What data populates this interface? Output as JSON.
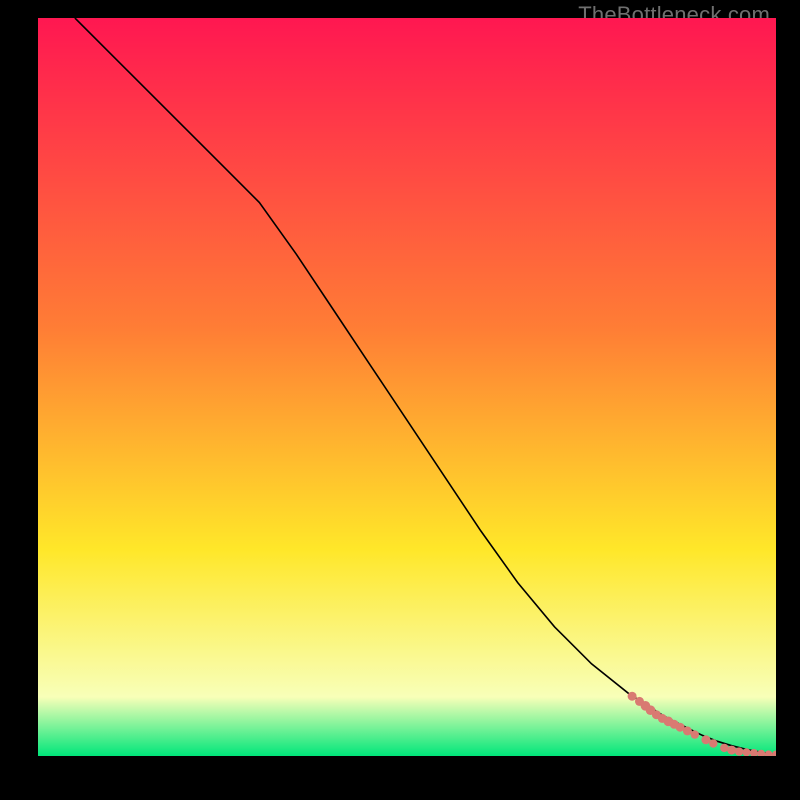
{
  "watermark": "TheBottleneck.com",
  "colors": {
    "grad_top": "#ff1751",
    "grad_orange": "#ff7d35",
    "grad_yellow": "#ffe729",
    "grad_pale": "#f8ffb8",
    "grad_green": "#00e67a",
    "points_fill": "#d97a72",
    "line": "#000000"
  },
  "chart_data": {
    "type": "line",
    "title": "",
    "xlabel": "",
    "ylabel": "",
    "xlim": [
      0,
      100
    ],
    "ylim": [
      0,
      100
    ],
    "series": [
      {
        "name": "black-curve",
        "x": [
          5,
          10,
          15,
          20,
          25,
          30,
          35,
          40,
          45,
          50,
          55,
          60,
          65,
          70,
          75,
          80,
          85,
          88,
          90,
          92,
          94,
          96,
          98,
          100
        ],
        "y": [
          100,
          95,
          90,
          85,
          80,
          75,
          68,
          60.5,
          53,
          45.5,
          38,
          30.5,
          23.5,
          17.5,
          12.5,
          8.5,
          5.3,
          3.8,
          2.8,
          2.0,
          1.4,
          0.9,
          0.5,
          0.2
        ]
      }
    ],
    "points": {
      "name": "highlight-points",
      "x": [
        80.5,
        81.5,
        82.3,
        83.0,
        83.8,
        84.6,
        85.4,
        86.2,
        87.0,
        88.0,
        89.0,
        90.5,
        91.5,
        93.0,
        94.0,
        95.0,
        96.0,
        97.0,
        98.0,
        99.0,
        100.0
      ],
      "y": [
        8.1,
        7.4,
        6.8,
        6.2,
        5.6,
        5.1,
        4.7,
        4.3,
        3.9,
        3.4,
        2.9,
        2.2,
        1.7,
        1.1,
        0.8,
        0.6,
        0.5,
        0.4,
        0.3,
        0.25,
        0.2
      ],
      "r": [
        4.5,
        4.5,
        4.8,
        4.8,
        4.5,
        4.5,
        4.8,
        4.5,
        4.5,
        4.5,
        4.2,
        4.5,
        4.2,
        4.2,
        4.5,
        4.2,
        4.0,
        4.0,
        4.0,
        3.8,
        4.0
      ]
    }
  }
}
